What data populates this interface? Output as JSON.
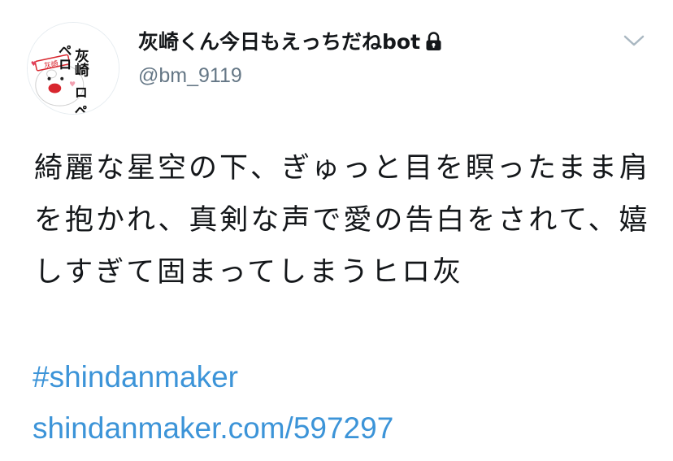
{
  "user": {
    "display_name": "灰崎くん今日もえっちだねbot",
    "handle": "@bm_9119",
    "avatar": {
      "badge_text": "灰崎",
      "column_right": "灰崎",
      "column_left": "ペロ",
      "column_bottom": "ロ ペ ロ"
    }
  },
  "tweet": {
    "text": "綺麗な星空の下、ぎゅっと目を瞑ったまま肩を抱かれ、真剣な声で愛の告白をされて、嬉しすぎて固まってしまうヒロ灰",
    "hashtag": "#shindanmaker",
    "link": "shindanmaker.com/597297"
  },
  "icons": {
    "lock": "lock-icon",
    "caret": "chevron-down-icon"
  },
  "colors": {
    "link": "#3c94d8",
    "secondary": "#657786",
    "text": "#14171a"
  }
}
